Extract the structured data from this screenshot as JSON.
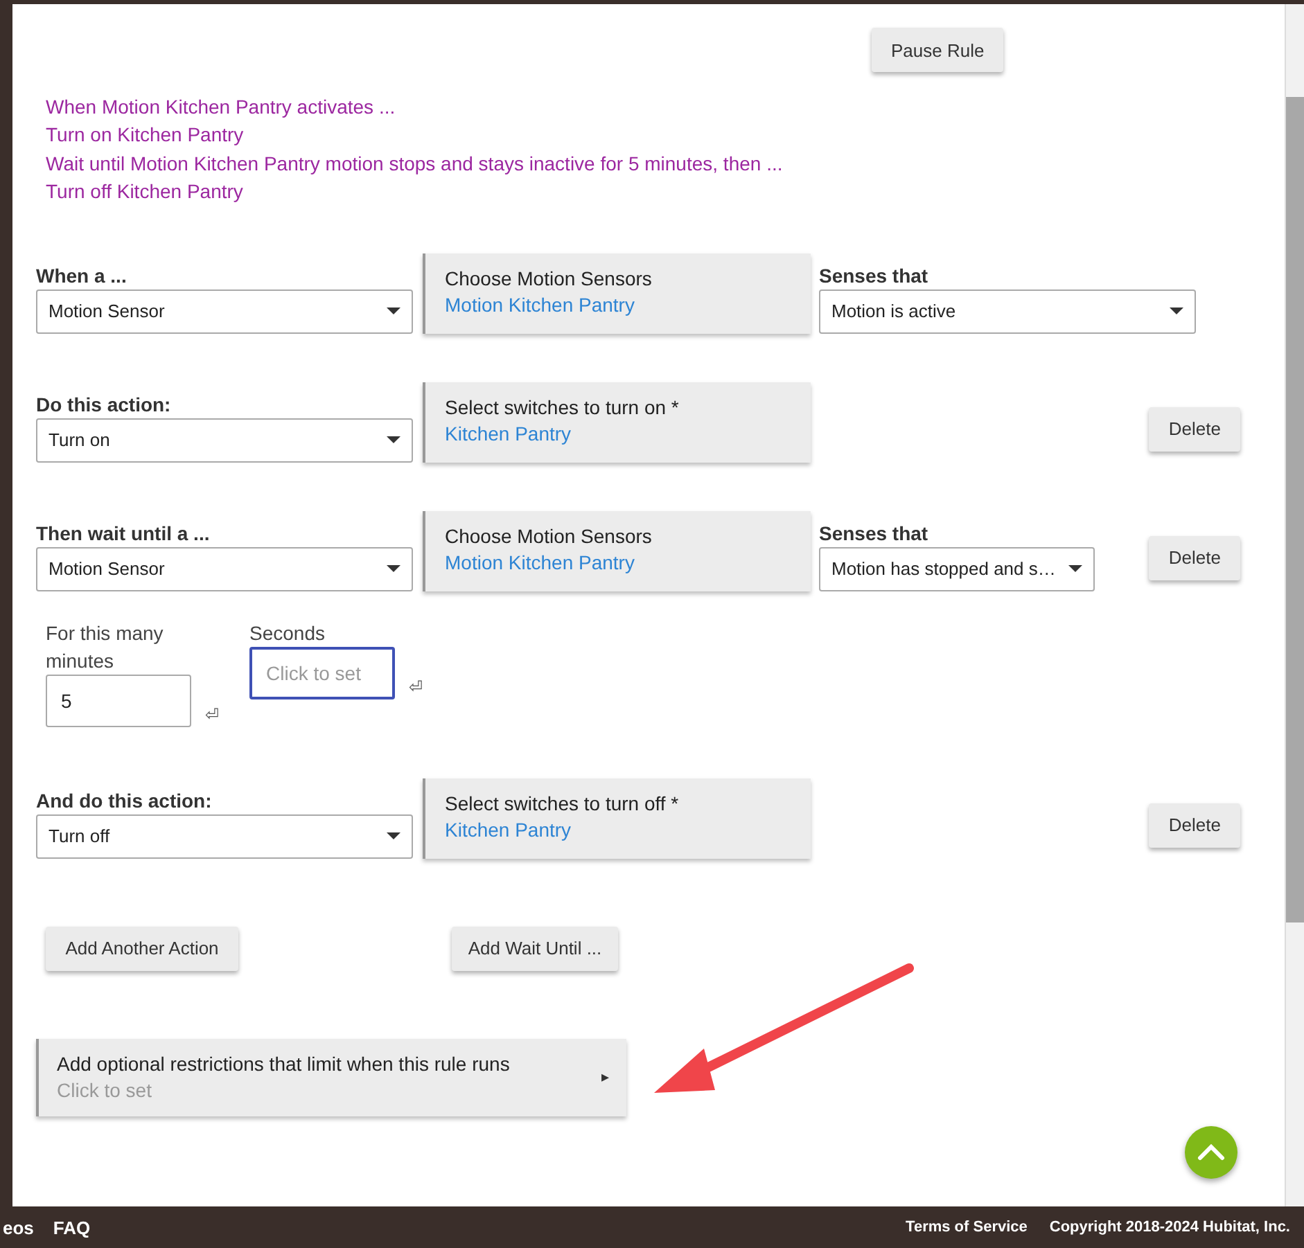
{
  "pause_button": "Pause Rule",
  "summary": [
    "When Motion Kitchen Pantry activates ...",
    "Turn on Kitchen Pantry",
    "Wait until Motion Kitchen Pantry motion stops and stays inactive for 5 minutes, then ...",
    "Turn off Kitchen Pantry"
  ],
  "sections": [
    {
      "label": "When a ...",
      "select": "Motion Sensor",
      "chooser": {
        "title": "Choose Motion Sensors",
        "value": "Motion Kitchen Pantry"
      },
      "senses": {
        "label": "Senses that",
        "select": "Motion is active"
      }
    },
    {
      "label": "Do this action:",
      "select": "Turn on",
      "chooser": {
        "title": "Select switches to turn on *",
        "value": "Kitchen Pantry"
      },
      "delete": "Delete"
    },
    {
      "label": "Then wait until a ...",
      "select": "Motion Sensor",
      "chooser": {
        "title": "Choose Motion Sensors",
        "value": "Motion Kitchen Pantry"
      },
      "senses": {
        "label": "Senses that",
        "select": "Motion has stopped and s…"
      },
      "delete": "Delete",
      "duration": [
        {
          "label": "For this many minutes",
          "value": "5",
          "focused": false,
          "enter": "⏎"
        },
        {
          "label": "Seconds",
          "placeholder": "Click to set",
          "focused": true,
          "enter": "⏎"
        }
      ]
    },
    {
      "label": "And do this action:",
      "select": "Turn off",
      "chooser": {
        "title": "Select switches to turn off *",
        "value": "Kitchen Pantry"
      },
      "delete": "Delete"
    }
  ],
  "add_buttons": [
    "Add Another Action",
    "Add Wait Until ..."
  ],
  "restrictions": {
    "title": "Add optional restrictions that limit when this rule runs",
    "hint": "Click to set",
    "arrow": "▸"
  },
  "footer": {
    "left_links": [
      "eos",
      "FAQ"
    ],
    "right_links": [
      "Terms of Service"
    ],
    "copyright": "Copyright 2018-2024 Hubitat, Inc."
  }
}
